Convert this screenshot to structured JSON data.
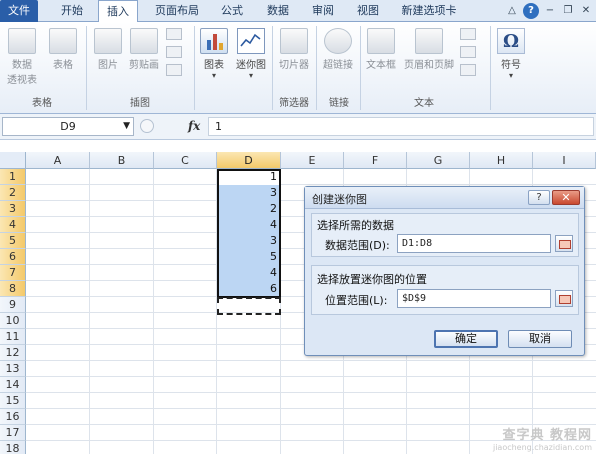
{
  "ribbon_tabs": [
    "文件",
    "开始",
    "插入",
    "页面布局",
    "公式",
    "数据",
    "审阅",
    "视图",
    "新建选项卡"
  ],
  "active_tab": "插入",
  "ribbon": {
    "groups": {
      "tables": "表格",
      "illustrations": "插图",
      "filter": "筛选器",
      "links": "链接",
      "text": "文本"
    },
    "buttons": {
      "pivot_line1": "数据",
      "pivot_line2": "透视表",
      "table": "表格",
      "picture": "图片",
      "clipart": "剪贴画",
      "chart": "图表",
      "sparkline": "迷你图",
      "slicer": "切片器",
      "hyperlink": "超链接",
      "textbox": "文本框",
      "header_footer": "页眉和页脚",
      "symbol": "符号",
      "symbol_glyph": "Ω"
    }
  },
  "formula_bar": {
    "name_box": "D9",
    "fx": "fx",
    "value": "1"
  },
  "sheet": {
    "columns": [
      "A",
      "B",
      "C",
      "D",
      "E",
      "F",
      "G",
      "H",
      "I"
    ],
    "rows": [
      "1",
      "2",
      "3",
      "4",
      "5",
      "6",
      "7",
      "8",
      "9",
      "10",
      "11",
      "12",
      "13",
      "14",
      "15",
      "16",
      "17",
      "18"
    ],
    "selected_column": "D",
    "column_d_values": [
      "1",
      "3",
      "2",
      "4",
      "3",
      "5",
      "4",
      "6"
    ]
  },
  "dialog": {
    "title": "创建迷你图",
    "help": "?",
    "close": "✕",
    "data_section_title": "选择所需的数据",
    "data_range_label": "数据范围(D):",
    "data_range_value": "D1:D8",
    "location_section_title": "选择放置迷你图的位置",
    "location_range_label": "位置范围(L):",
    "location_range_value": "$D$9",
    "ok": "确定",
    "cancel": "取消"
  },
  "watermark": {
    "line1": "查字典 教程网",
    "line2": "jiaocheng.chazidian.com"
  },
  "colors": {
    "file_tab": "#2a5ea8",
    "selection_fill": "#bcd6f3",
    "header_highlight": "#f4c96a",
    "dialog_bg": "#dce7f5"
  }
}
